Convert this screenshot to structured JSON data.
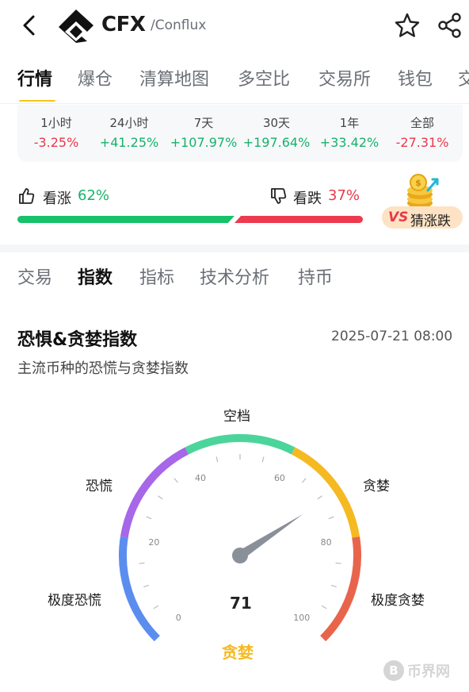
{
  "header": {
    "symbol": "CFX",
    "name": "/Conflux",
    "icons": {
      "back": "chevron-left-icon",
      "logo": "conflux-logo",
      "favorite": "star-icon",
      "share": "share-icon"
    }
  },
  "tabs": [
    {
      "label": "行情",
      "active": true
    },
    {
      "label": "爆仓",
      "active": false
    },
    {
      "label": "清算地图",
      "active": false
    },
    {
      "label": "多空比",
      "active": false
    },
    {
      "label": "交易所",
      "active": false
    },
    {
      "label": "钱包",
      "active": false
    },
    {
      "label": "交",
      "active": false
    }
  ],
  "performance": [
    {
      "period": "1小时",
      "change": "-3.25%",
      "direction": "down"
    },
    {
      "period": "24小时",
      "change": "+41.25%",
      "direction": "up"
    },
    {
      "period": "7天",
      "change": "+107.97%",
      "direction": "up"
    },
    {
      "period": "30天",
      "change": "+197.64%",
      "direction": "up"
    },
    {
      "period": "1年",
      "change": "+33.42%",
      "direction": "up"
    },
    {
      "period": "全部",
      "change": "-27.31%",
      "direction": "down"
    }
  ],
  "sentiment": {
    "bull_label": "看涨",
    "bull_pct": "62%",
    "bear_label": "看跌",
    "bear_pct": "37%",
    "bull_fraction": 0.62
  },
  "guess": {
    "vs": "VS",
    "label": "猜涨跌"
  },
  "subtabs": [
    {
      "label": "交易",
      "active": false
    },
    {
      "label": "指数",
      "active": true
    },
    {
      "label": "指标",
      "active": false
    },
    {
      "label": "技术分析",
      "active": false
    },
    {
      "label": "持币",
      "active": false
    }
  ],
  "fear_greed": {
    "title": "恐惧&贪婪指数",
    "timestamp": "2025-07-21 08:00",
    "subtitle": "主流币种的恐慌与贪婪指数",
    "value": 71,
    "value_text": "71",
    "status": "贪婪",
    "zones": [
      {
        "label": "极度恐慌",
        "color": "#5b8def"
      },
      {
        "label": "恐慌",
        "color": "#a667e8"
      },
      {
        "label": "空档",
        "color": "#4cd59a"
      },
      {
        "label": "贪婪",
        "color": "#f5b921"
      },
      {
        "label": "极度贪婪",
        "color": "#e8654c"
      }
    ],
    "ticks": [
      "0",
      "20",
      "40",
      "60",
      "80",
      "100"
    ]
  },
  "watermark": {
    "text": "币界网"
  },
  "colors": {
    "up": "#17b26a",
    "down": "#e8394a",
    "accent": "#f5c518"
  }
}
